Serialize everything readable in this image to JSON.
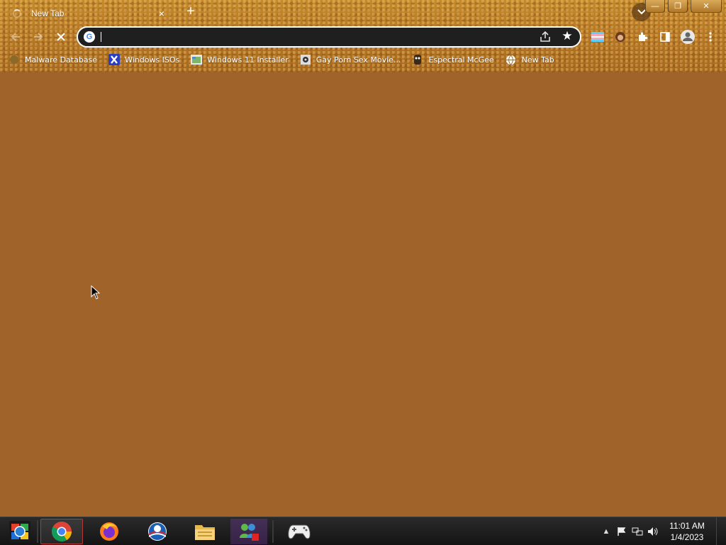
{
  "browser": {
    "tab_title": "New Tab",
    "tab_close": "×",
    "new_tab": "+",
    "window_buttons": {
      "minimize": "—",
      "restore": "❐",
      "close": "✕"
    }
  },
  "toolbar": {
    "address_value": "",
    "address_placeholder": ""
  },
  "bookmarks": [
    {
      "label": "Malware Database",
      "icon": "malware-database-icon"
    },
    {
      "label": "Windows ISOs",
      "icon": "windows-isos-icon"
    },
    {
      "label": "Windows 11 Installer",
      "icon": "installer-icon"
    },
    {
      "label": "Gay Porn Sex Movie...",
      "icon": "movie-site-icon"
    },
    {
      "label": "Espectral McGee",
      "icon": "espectral-icon"
    },
    {
      "label": "New Tab",
      "icon": "globe-icon"
    }
  ],
  "taskbar": {
    "apps": [
      {
        "name": "start-button",
        "icon": "windows-orb-icon"
      },
      {
        "name": "chrome",
        "icon": "chrome-icon",
        "active": true
      },
      {
        "name": "firefox",
        "icon": "firefox-icon"
      },
      {
        "name": "obama-logo-app",
        "icon": "blue-circle-icon"
      },
      {
        "name": "file-explorer",
        "icon": "folder-icon"
      },
      {
        "name": "messenger",
        "icon": "messenger-icon"
      },
      {
        "name": "game-controller",
        "icon": "gamepad-icon"
      }
    ],
    "clock_time": "11:01 AM",
    "clock_date": "1/4/2023"
  },
  "colors": {
    "page_background": "#a0632a",
    "omnibox_background": "#1f1f1f",
    "taskbar": "#1a1a1a"
  }
}
